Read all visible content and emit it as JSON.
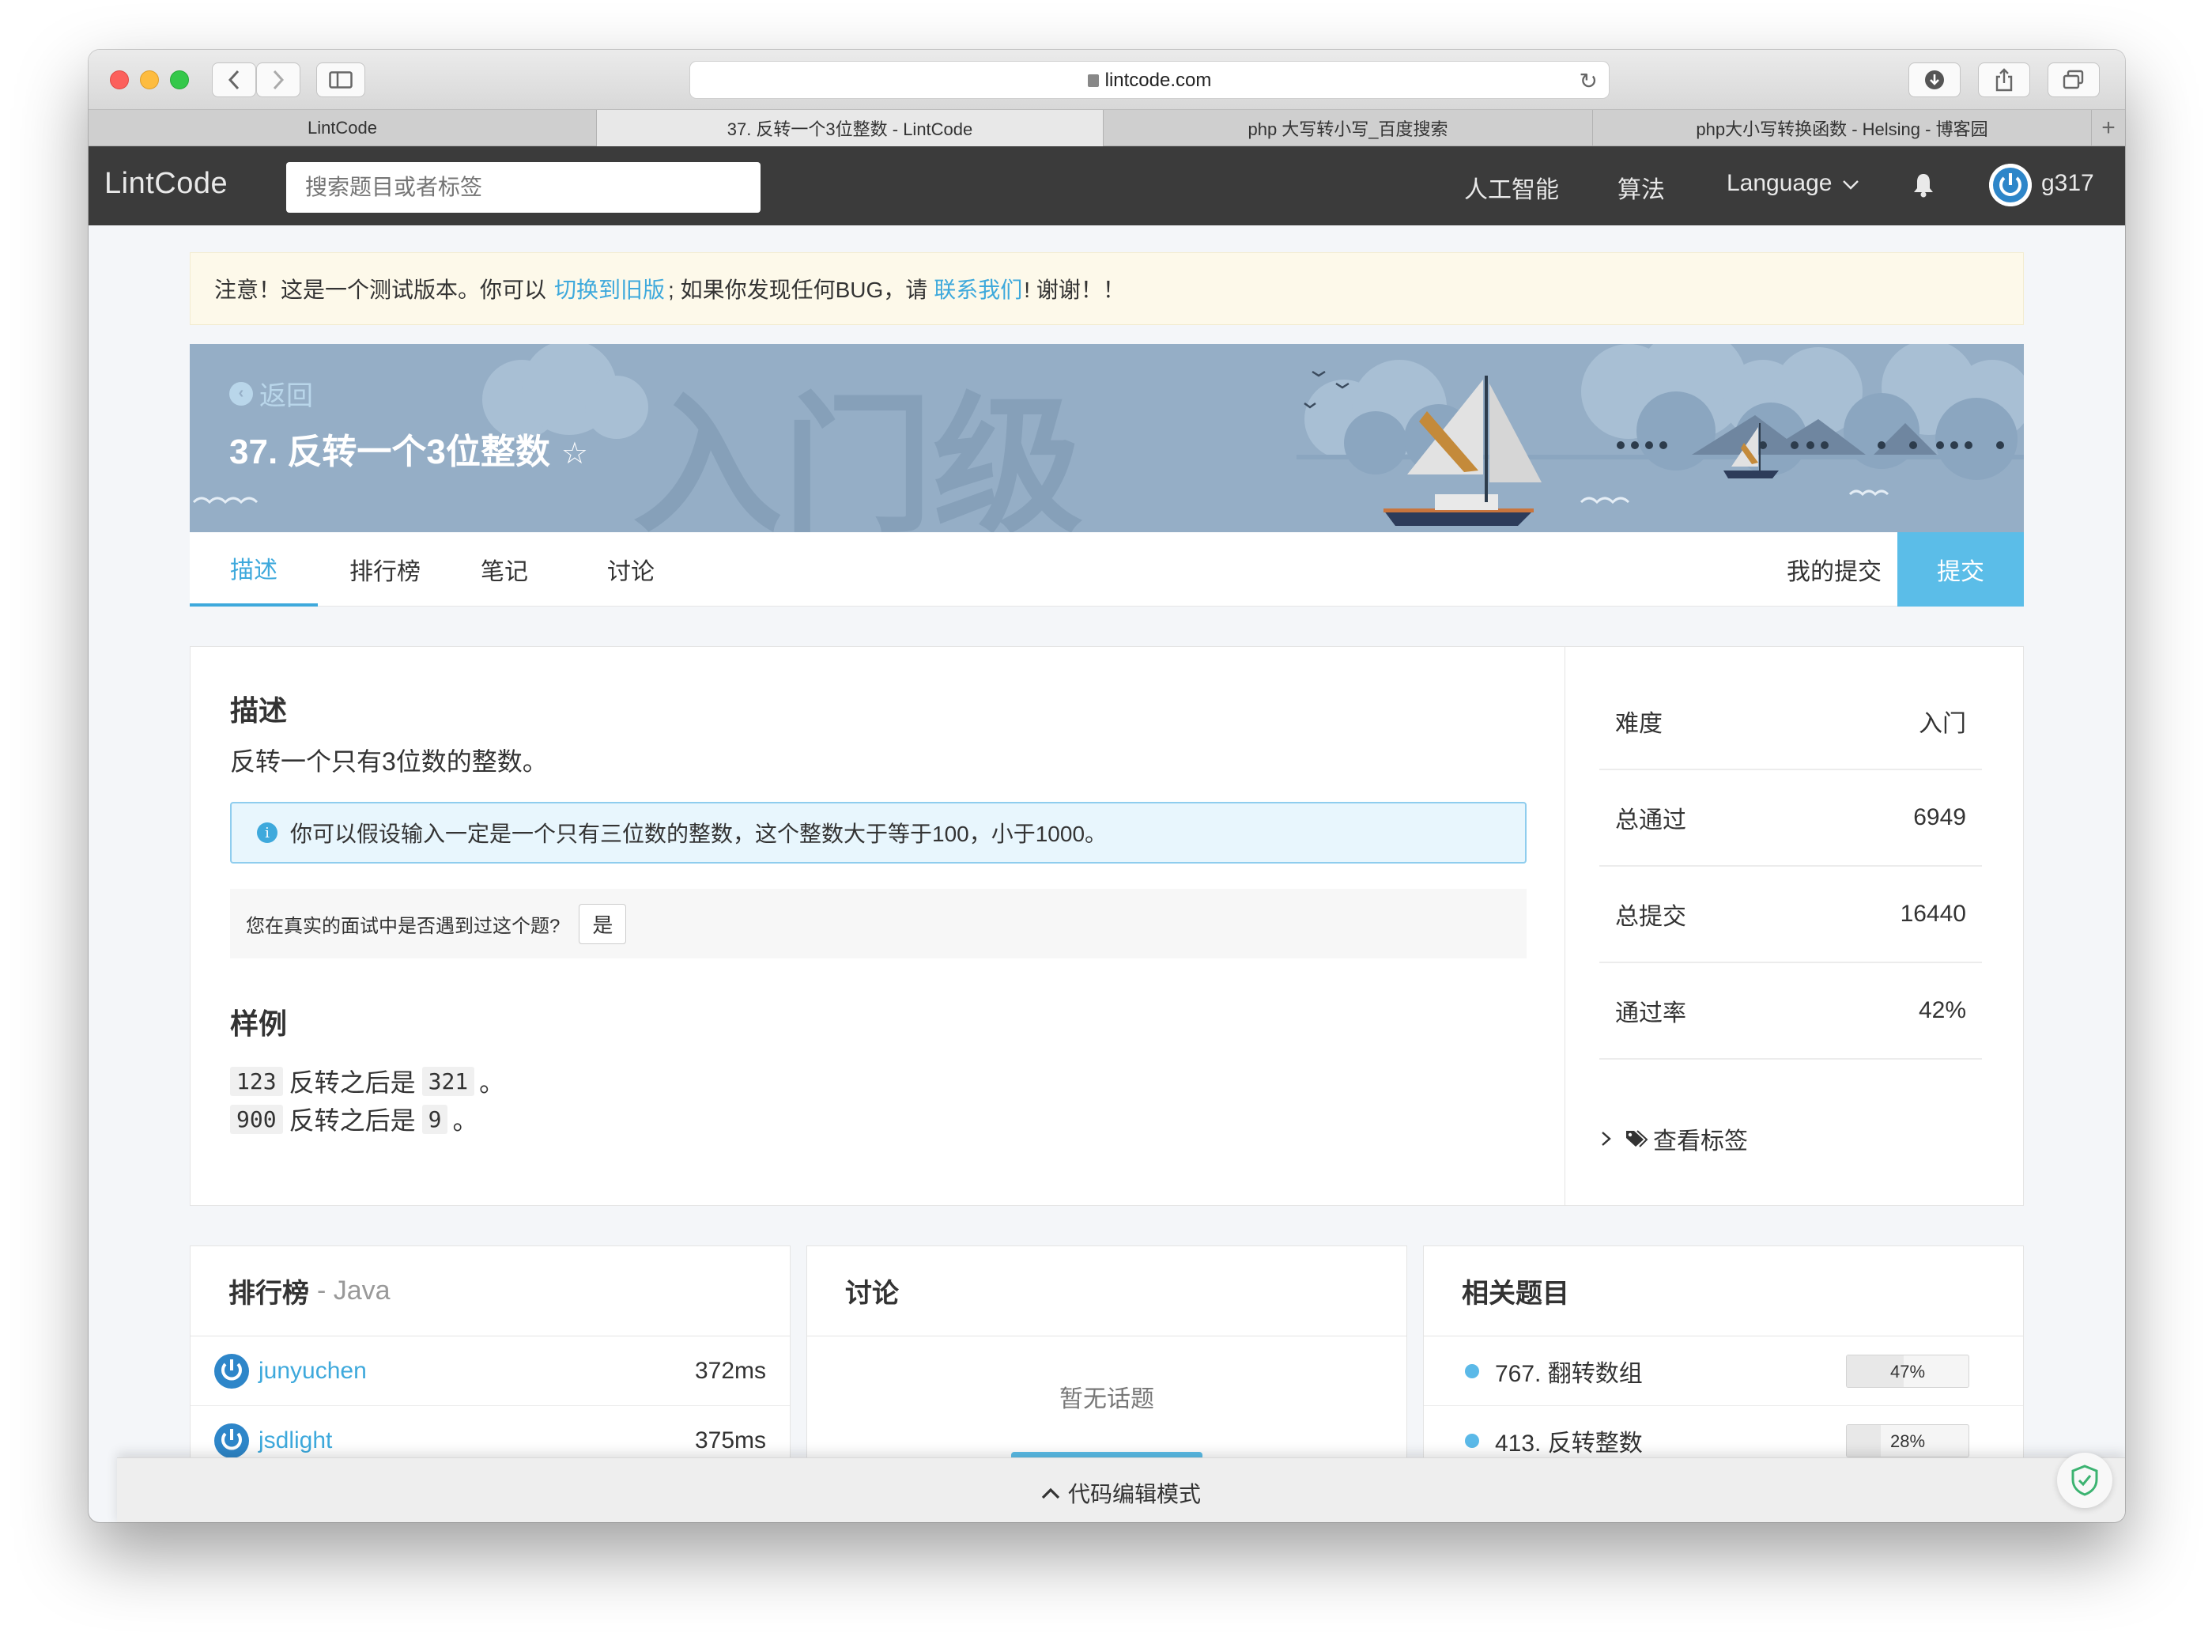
{
  "browser": {
    "url": "lintcode.com",
    "tabs": [
      {
        "label": "LintCode",
        "active": false
      },
      {
        "label": "37. 反转一个3位整数 - LintCode",
        "active": true
      },
      {
        "label": "php 大写转小写_百度搜索",
        "active": false
      },
      {
        "label": "php大小写转换函数 - Helsing - 博客园",
        "active": false
      }
    ],
    "new_tab": "+"
  },
  "navbar": {
    "logo": "LintCode",
    "search_placeholder": "搜索题目或者标签",
    "ai_label": "人工智能",
    "algorithm_label": "算法",
    "language_label": "Language",
    "username": "g317"
  },
  "notice": {
    "prefix": "注意！这是一个测试版本。你可以",
    "switch_link": "切换到旧版",
    "middle": "; 如果你发现任何BUG，请",
    "contact_link": "联系我们",
    "suffix": "! 谢谢！！"
  },
  "banner": {
    "back_label": "返回",
    "title": "37. 反转一个3位整数",
    "watermark": "入门级"
  },
  "subtabs": {
    "description": "描述",
    "ranking": "排行榜",
    "notes": "笔记",
    "discussion": "讨论",
    "my_submissions": "我的提交",
    "submit": "提交"
  },
  "problem": {
    "description_title": "描述",
    "description_text": "反转一个只有3位数的整数。",
    "info_icon": "i",
    "info_text": "你可以假设输入一定是一个只有三位数的整数，这个整数大于等于100，小于1000。",
    "interview_question": "您在真实的面试中是否遇到过这个题?",
    "interview_yes": "是",
    "example_title": "样例",
    "examples": [
      {
        "input": "123",
        "mid": "反转之后是",
        "output": "321",
        "end": "。"
      },
      {
        "input": "900",
        "mid": "反转之后是",
        "output": "9",
        "end": "。"
      }
    ]
  },
  "stats": [
    {
      "label": "难度",
      "value": "入门"
    },
    {
      "label": "总通过",
      "value": "6949"
    },
    {
      "label": "总提交",
      "value": "16440"
    },
    {
      "label": "通过率",
      "value": "42%"
    }
  ],
  "tags_link": "查看标签",
  "ranking_card": {
    "title": "排行榜",
    "language": "- Java",
    "rows": [
      {
        "user": "junyuchen",
        "time": "372ms"
      },
      {
        "user": "jsdlight",
        "time": "375ms"
      }
    ]
  },
  "discussion_card": {
    "title": "讨论",
    "empty": "暂无话题"
  },
  "related_card": {
    "title": "相关题目",
    "rows": [
      {
        "name": "767. 翻转数组",
        "rate": "47%",
        "rate_value": 47
      },
      {
        "name": "413. 反转整数",
        "rate": "28%",
        "rate_value": 28
      }
    ]
  },
  "code_bar": {
    "label": "代码编辑模式"
  },
  "colors": {
    "accent": "#3ea9dc",
    "navbar": "#3b3b3b",
    "banner": "#95aec6",
    "submit": "#5bbde8"
  }
}
